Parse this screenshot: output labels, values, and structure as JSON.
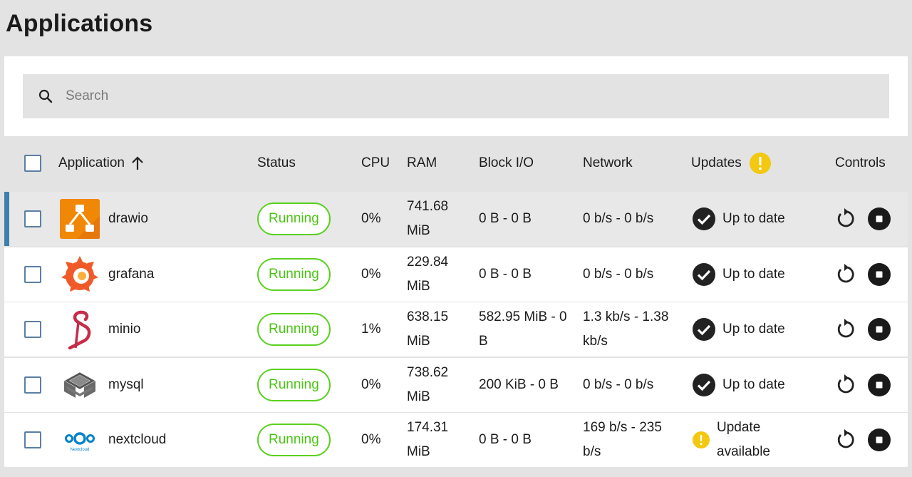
{
  "page": {
    "title": "Applications"
  },
  "search": {
    "placeholder": "Search",
    "value": ""
  },
  "table": {
    "headers": {
      "application": "Application",
      "status": "Status",
      "cpu": "CPU",
      "ram": "RAM",
      "block_io": "Block I/O",
      "network": "Network",
      "updates": "Updates",
      "controls": "Controls"
    },
    "sort": {
      "column": "Application",
      "direction": "ascending"
    },
    "rows": [
      {
        "name": "drawio",
        "status": "Running",
        "cpu": "0%",
        "ram": "741.68 MiB",
        "block_io": "0 B - 0 B",
        "network": "0 b/s - 0 b/s",
        "update": "Up to date",
        "selected": true
      },
      {
        "name": "grafana",
        "status": "Running",
        "cpu": "0%",
        "ram": "229.84 MiB",
        "block_io": "0 B - 0 B",
        "network": "0 b/s - 0 b/s",
        "update": "Up to date",
        "selected": false
      },
      {
        "name": "minio",
        "status": "Running",
        "cpu": "1%",
        "ram": "638.15 MiB",
        "block_io": "582.95 MiB - 0 B",
        "network": "1.3 kb/s - 1.38 kb/s",
        "update": "Up to date",
        "selected": false
      },
      {
        "name": "mysql",
        "status": "Running",
        "cpu": "0%",
        "ram": "738.62 MiB",
        "block_io": "200 KiB - 0 B",
        "network": "0 b/s - 0 b/s",
        "update": "Up to date",
        "selected": false
      },
      {
        "name": "nextcloud",
        "status": "Running",
        "cpu": "0%",
        "ram": "174.31 MiB",
        "block_io": "0 B - 0 B",
        "network": "169 b/s - 235 b/s",
        "update": "Update available",
        "selected": false
      }
    ]
  },
  "logos": {
    "nextcloud_caption": "Nextcloud"
  },
  "colors": {
    "running_green": "#5ad11f",
    "warning_yellow": "#f2c811",
    "selected_accent": "#3f7fae",
    "checkbox_border": "#5b7fa3",
    "drawio_orange": "#f08705",
    "grafana_orange": "#f05a28",
    "minio_red": "#c72c48",
    "nextcloud_blue": "#0082c9"
  },
  "icons": {
    "search": "search-icon",
    "sort": "arrow-up-icon",
    "updates_warning": "warning-icon",
    "up_to_date": "check-circle-icon",
    "update_available": "warning-icon",
    "restart": "restart-icon",
    "stop": "stop-icon"
  }
}
